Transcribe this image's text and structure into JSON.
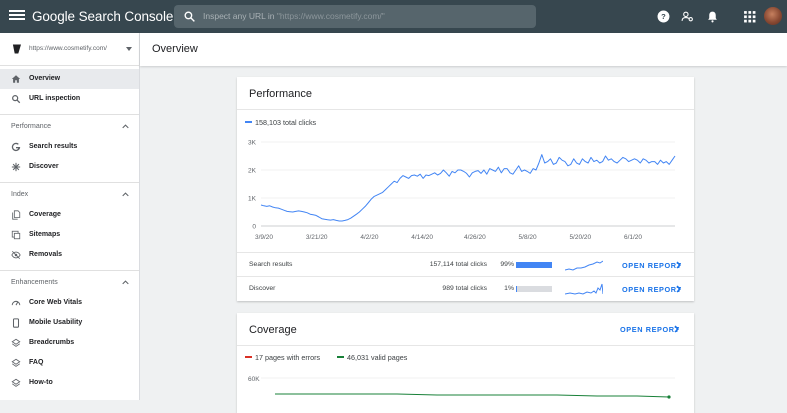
{
  "topbar": {
    "menu_icon": "hamburger-menu-icon",
    "logo_brand": "Google",
    "logo_product": "Search Console",
    "search_placeholder": "Inspect any URL in",
    "search_property": "\"https://www.cosmetify.com/\"",
    "icons": [
      "help-icon",
      "manage-users-icon",
      "notifications-icon",
      "apps-grid-icon"
    ],
    "bg_color": "#37474f"
  },
  "sidebar": {
    "property_url": "https://www.cosmetify.com/",
    "items_top": [
      {
        "label": "Overview",
        "icon": "home-icon",
        "active": true
      },
      {
        "label": "URL inspection",
        "icon": "search-icon",
        "active": false
      }
    ],
    "sections": [
      {
        "title": "Performance",
        "items": [
          {
            "label": "Search results",
            "icon": "google-g-icon"
          },
          {
            "label": "Discover",
            "icon": "asterisk-icon"
          }
        ]
      },
      {
        "title": "Index",
        "items": [
          {
            "label": "Coverage",
            "icon": "file-copy-icon"
          },
          {
            "label": "Sitemaps",
            "icon": "sitemap-icon"
          },
          {
            "label": "Removals",
            "icon": "eye-off-icon"
          }
        ]
      },
      {
        "title": "Enhancements",
        "items": [
          {
            "label": "Core Web Vitals",
            "icon": "speed-icon"
          },
          {
            "label": "Mobile Usability",
            "icon": "phone-icon"
          },
          {
            "label": "Breadcrumbs",
            "icon": "layers-icon"
          },
          {
            "label": "FAQ",
            "icon": "layers-icon"
          },
          {
            "label": "How-to",
            "icon": "layers-icon"
          }
        ]
      }
    ]
  },
  "header": {
    "title": "Overview"
  },
  "performance": {
    "title": "Performance",
    "legend": "158,103 total clicks",
    "series_color": "#4285f4",
    "rows": [
      {
        "label": "Search results",
        "clicks": "157,114 total clicks",
        "pct": "99%",
        "pct_value": 99,
        "open": "OPEN REPORT"
      },
      {
        "label": "Discover",
        "clicks": "989 total clicks",
        "pct": "1%",
        "pct_value": 1,
        "open": "OPEN REPORT"
      }
    ]
  },
  "coverage": {
    "title": "Coverage",
    "open": "OPEN REPORT",
    "legend_errors": "17 pages with errors",
    "legend_valid": "46,031 valid pages",
    "error_color": "#d93025",
    "valid_color": "#188038",
    "ytick_top": "60K"
  },
  "chart_data": [
    {
      "type": "line",
      "title": "",
      "series": [
        {
          "name": "158,103 total clicks",
          "color": "#4285f4",
          "values": [
            750,
            720,
            700,
            720,
            680,
            650,
            640,
            600,
            560,
            520,
            510,
            500,
            520,
            540,
            520,
            500,
            470,
            420,
            400,
            380,
            320,
            260,
            240,
            220,
            210,
            230,
            200,
            180,
            180,
            200,
            230,
            280,
            350,
            420,
            500,
            600,
            700,
            820,
            950,
            1050,
            1100,
            1150,
            1200,
            1300,
            1400,
            1500,
            1600,
            1550,
            1700,
            1800,
            1750,
            1700,
            1800,
            1820,
            1780,
            1850,
            1700,
            1820,
            1800,
            1850,
            1900,
            1820,
            1880,
            2000,
            1900,
            1780,
            1950,
            1900,
            2000,
            2000,
            1950,
            1880,
            1750,
            1900,
            1950,
            1980,
            1880,
            2000,
            1850,
            2050,
            2000,
            1950,
            2100,
            1900,
            2050,
            2050,
            1900,
            1850,
            2000,
            2150,
            1950,
            2000,
            1950,
            1880,
            2050,
            2000,
            2250,
            2550,
            2250,
            2300,
            2400,
            2200,
            2250,
            2450,
            2350,
            2300,
            2150,
            2200,
            2400,
            2250,
            2200,
            2400,
            2300,
            2250,
            2450,
            2300,
            2350,
            2250,
            2300,
            2500,
            2350,
            2400,
            2300,
            2250,
            2350,
            2450,
            2400,
            2300,
            2350,
            2400,
            2350,
            2250,
            2400,
            2350,
            2250,
            2300,
            2300,
            2200,
            2350,
            2250,
            2300,
            2200,
            2350,
            2500
          ]
        }
      ],
      "x_ticks": [
        "3/9/20",
        "3/21/20",
        "4/2/20",
        "4/14/20",
        "4/26/20",
        "5/8/20",
        "5/20/20",
        "6/1/20"
      ],
      "y_ticks": [
        "0",
        "1K",
        "2K",
        "3K"
      ],
      "ylim": [
        0,
        3000
      ],
      "grid": true
    }
  ]
}
